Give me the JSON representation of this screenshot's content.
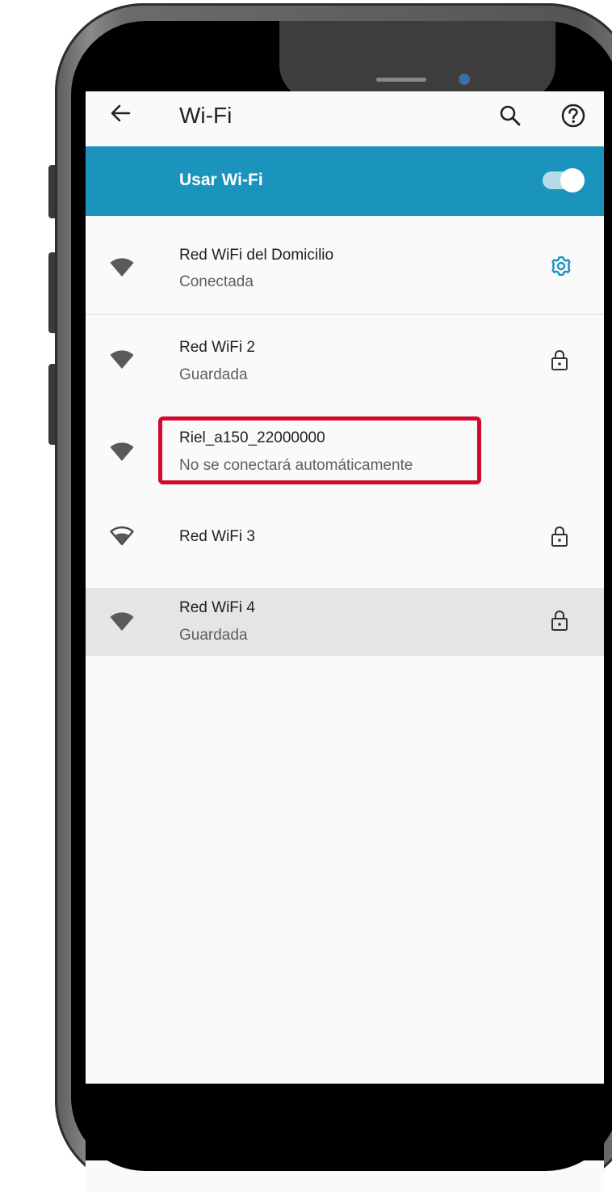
{
  "appbar": {
    "back_icon": "arrow-left-icon",
    "title": "Wi-Fi",
    "search_icon": "search-icon",
    "help_icon": "help-icon"
  },
  "wifi_toggle": {
    "label": "Usar Wi-Fi",
    "enabled": true,
    "accent": "#1a93bd"
  },
  "networks": [
    {
      "name": "Red WiFi del Domicilio",
      "status": "Conectada",
      "signal_icon": "wifi-full-icon",
      "trailing_icon": "gear-icon"
    },
    {
      "name": "Red WiFi 2",
      "status": "Guardada",
      "signal_icon": "wifi-full-icon",
      "trailing_icon": "lock-icon"
    },
    {
      "name": "Riel_a150_22000000",
      "status": "No se conectará automáticamente",
      "signal_icon": "wifi-full-icon",
      "trailing_icon": ""
    },
    {
      "name": "Red WiFi 3",
      "status": "",
      "signal_icon": "wifi-outline-icon",
      "trailing_icon": "lock-icon"
    },
    {
      "name": "Red WiFi 4",
      "status": "Guardada",
      "signal_icon": "wifi-full-icon",
      "trailing_icon": "lock-icon"
    }
  ],
  "highlight": {
    "color": "#d2092e"
  },
  "navbar": {
    "back_icon": "nav-back-icon",
    "home_icon": "nav-home-icon",
    "recents_icon": "nav-recents-icon"
  }
}
